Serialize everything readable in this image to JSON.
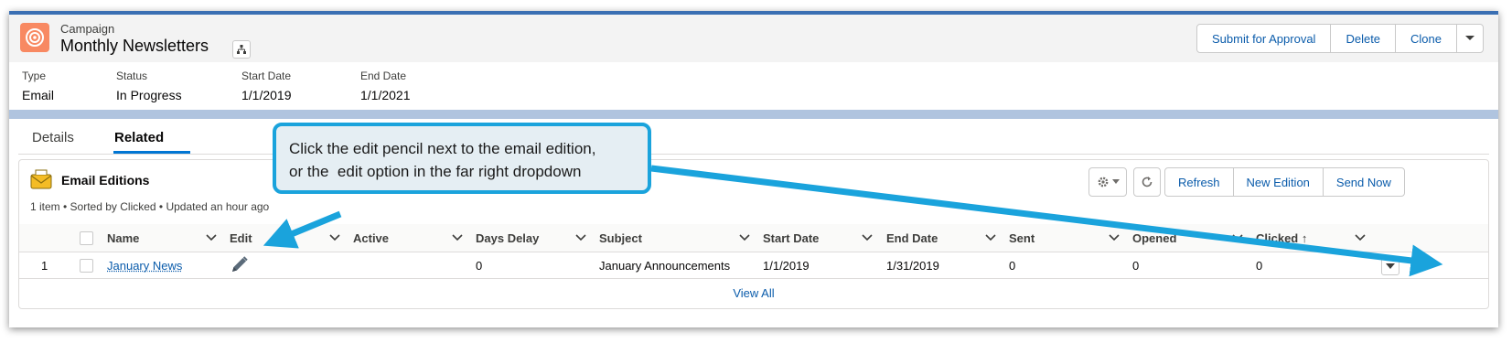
{
  "header": {
    "object_type": "Campaign",
    "record_name": "Monthly Newsletters",
    "actions": [
      "Submit for Approval",
      "Delete",
      "Clone"
    ],
    "object_icon": "campaign-target-icon",
    "object_icon_color": "#f88962"
  },
  "highlights": {
    "fields": [
      {
        "label": "Type",
        "value": "Email"
      },
      {
        "label": "Status",
        "value": "In Progress"
      },
      {
        "label": "Start Date",
        "value": "1/1/2019"
      },
      {
        "label": "End Date",
        "value": "1/1/2021"
      }
    ]
  },
  "tabs": [
    {
      "label": "Details",
      "active": false
    },
    {
      "label": "Related",
      "active": true
    }
  ],
  "related_list": {
    "title": "Email Editions",
    "icon": "email-envelope-icon",
    "meta": "1 item • Sorted by Clicked • Updated an hour ago",
    "buttons": [
      "Refresh",
      "New Edition",
      "Send Now"
    ],
    "columns": [
      "Name",
      "Edit",
      "Active",
      "Days Delay",
      "Subject",
      "Start Date",
      "End Date",
      "Sent",
      "Opened",
      "Clicked ↑"
    ],
    "rows": [
      {
        "num": "1",
        "name": "January News",
        "active": "",
        "days_delay": "0",
        "subject": "January Announcements",
        "start_date": "1/1/2019",
        "end_date": "1/31/2019",
        "sent": "0",
        "opened": "0",
        "clicked": "0"
      }
    ],
    "view_all": "View All"
  },
  "callout": {
    "line1": "Click the edit pencil next to the email edition,",
    "line2": "or the  edit option in the far right dropdown",
    "accent": "#1aa3dc"
  },
  "colors": {
    "link": "#0b5cab",
    "banner": "#b0c4df",
    "accent_tab": "#0176d3"
  }
}
